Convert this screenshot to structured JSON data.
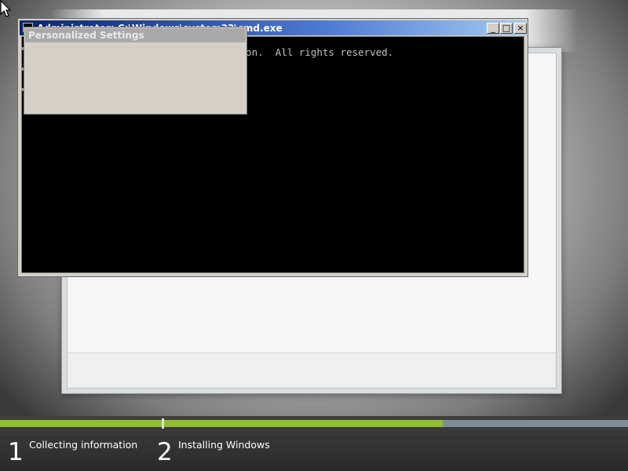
{
  "cmd_window": {
    "title": "Administrator: C:\\Windows\\system32\\cmd.exe",
    "console_line": "tion.  All rights reserved.",
    "minimize_glyph": "_",
    "maximize_glyph": "□",
    "close_glyph": "×"
  },
  "personalized_settings": {
    "title": "Personalized Settings"
  },
  "progress": {
    "collecting_fraction": 1.0,
    "installing_fraction": 0.6
  },
  "steps": [
    {
      "number": "1",
      "label": "Collecting information"
    },
    {
      "number": "2",
      "label": "Installing Windows"
    }
  ],
  "icons": {
    "cursor": "mouse-pointer-icon",
    "cmd": "console-icon"
  },
  "colors": {
    "progress_green": "#8fbf2f",
    "progress_track": "#7f8c99",
    "titlebar_blue": "#0a246a",
    "console_bg": "#000000"
  }
}
